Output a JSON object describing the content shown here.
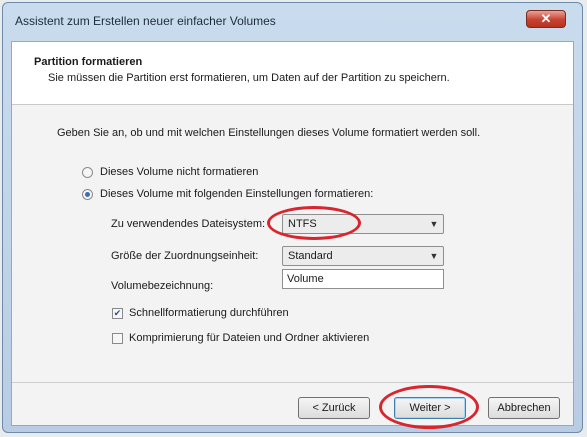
{
  "window": {
    "title": "Assistent zum Erstellen neuer einfacher Volumes",
    "close_icon": "close-icon"
  },
  "header": {
    "title": "Partition formatieren",
    "description": "Sie müssen die Partition erst formatieren, um Daten auf der Partition zu speichern."
  },
  "instruction": "Geben Sie an, ob und mit welchen Einstellungen dieses Volume formatiert werden soll.",
  "options": {
    "no_format": {
      "label": "Dieses Volume nicht formatieren",
      "selected": false
    },
    "format": {
      "label": "Dieses Volume mit folgenden Einstellungen formatieren:",
      "selected": true
    }
  },
  "settings": {
    "filesystem_label": "Zu verwendendes Dateisystem:",
    "filesystem_value": "NTFS",
    "allocation_label": "Größe der Zuordnungseinheit:",
    "allocation_value": "Standard",
    "volume_label": "Volumebezeichnung:",
    "volume_value": "Volume"
  },
  "checkboxes": {
    "quick_format": {
      "label": "Schnellformatierung durchführen",
      "checked": true
    },
    "compression": {
      "label": "Komprimierung für Dateien und Ordner aktivieren",
      "checked": false
    }
  },
  "buttons": {
    "back": "< Zurück",
    "next": "Weiter >",
    "cancel": "Abbrechen"
  },
  "colors": {
    "highlight_ellipse": "#d8262f",
    "close_button": "#c7422f"
  }
}
